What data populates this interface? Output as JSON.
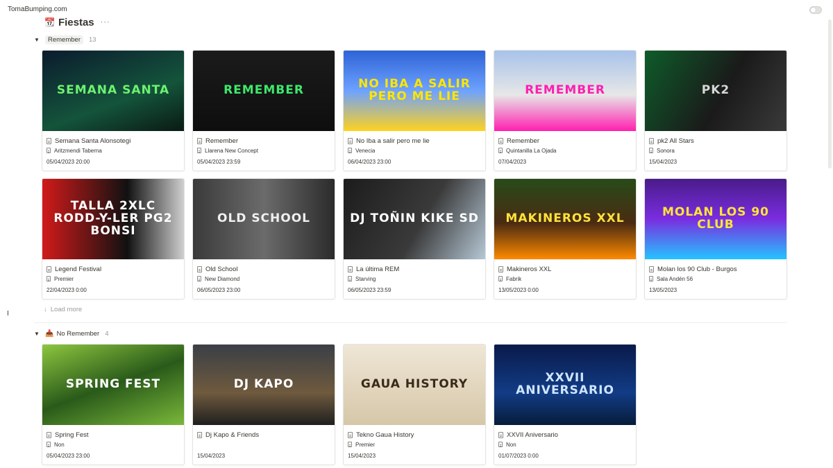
{
  "site": {
    "name": "TomaBumping.com"
  },
  "database": {
    "icon": "calendar-icon",
    "title": "Fiestas",
    "more": "···"
  },
  "groups": [
    {
      "label": "Remember",
      "count": "13",
      "cards": [
        {
          "title": "Semana Santa Alonsotegi",
          "venue": "Aritzmendi Taberna",
          "date": "05/04/2023 20:00",
          "cover_text": "Semana Santa",
          "cover_sub": ""
        },
        {
          "title": "Remember",
          "venue": "Llarena New Concept",
          "date": "05/04/2023 23:59",
          "cover_text": "Remember",
          "cover_sub": ""
        },
        {
          "title": "No Iba a salir pero me lie",
          "venue": "Venecia",
          "date": "06/04/2023 23:00",
          "cover_text": "No iba a salir pero me lie",
          "cover_sub": ""
        },
        {
          "title": "Remember",
          "venue": "Quintanilla La Ojada",
          "date": "07/04/2023",
          "cover_text": "Remember",
          "cover_sub": ""
        },
        {
          "title": "pk2 All Stars",
          "venue": "Sonora",
          "date": "15/04/2023",
          "cover_text": "pk2",
          "cover_sub": ""
        },
        {
          "title": "Legend Festival",
          "venue": "Premier",
          "date": "22/04/2023 0:00",
          "cover_text": "Talla 2XLC Rodd-Y-Ler PG2 Bonsi",
          "cover_sub": ""
        },
        {
          "title": "Old School",
          "venue": "New Diamond",
          "date": "06/05/2023 23:00",
          "cover_text": "Old School",
          "cover_sub": ""
        },
        {
          "title": "La última REM",
          "venue": "Starving",
          "date": "06/05/2023 23:59",
          "cover_text": "DJ Toñin Kike SD",
          "cover_sub": ""
        },
        {
          "title": "Makineros XXL",
          "venue": "Fabrik",
          "date": "13/05/2023 0:00",
          "cover_text": "Makineros XXL",
          "cover_sub": ""
        },
        {
          "title": "Molan los 90 Club - Burgos",
          "venue": "Sala Andén 56",
          "date": "13/05/2023",
          "cover_text": "Molan los 90 Club",
          "cover_sub": ""
        }
      ]
    },
    {
      "label": "No Remember",
      "count": "4",
      "icon": "inbox-icon",
      "cards": [
        {
          "title": "Spring Fest",
          "venue": "Non",
          "date": "05/04/2023 23:00",
          "cover_text": "Spring Fest",
          "cover_sub": ""
        },
        {
          "title": "Dj Kapo & Friends",
          "venue": "",
          "date": "15/04/2023",
          "cover_text": "DJ Kapo",
          "cover_sub": ""
        },
        {
          "title": "Tekno Gaua History",
          "venue": "Premier",
          "date": "15/04/2023",
          "cover_text": "Gaua History",
          "cover_sub": ""
        },
        {
          "title": "XXVII Aniversario",
          "venue": "Non",
          "date": "01/07/2023 0:00",
          "cover_text": "XXVII Aniversario",
          "cover_sub": ""
        }
      ]
    }
  ],
  "load_more": "Load more"
}
